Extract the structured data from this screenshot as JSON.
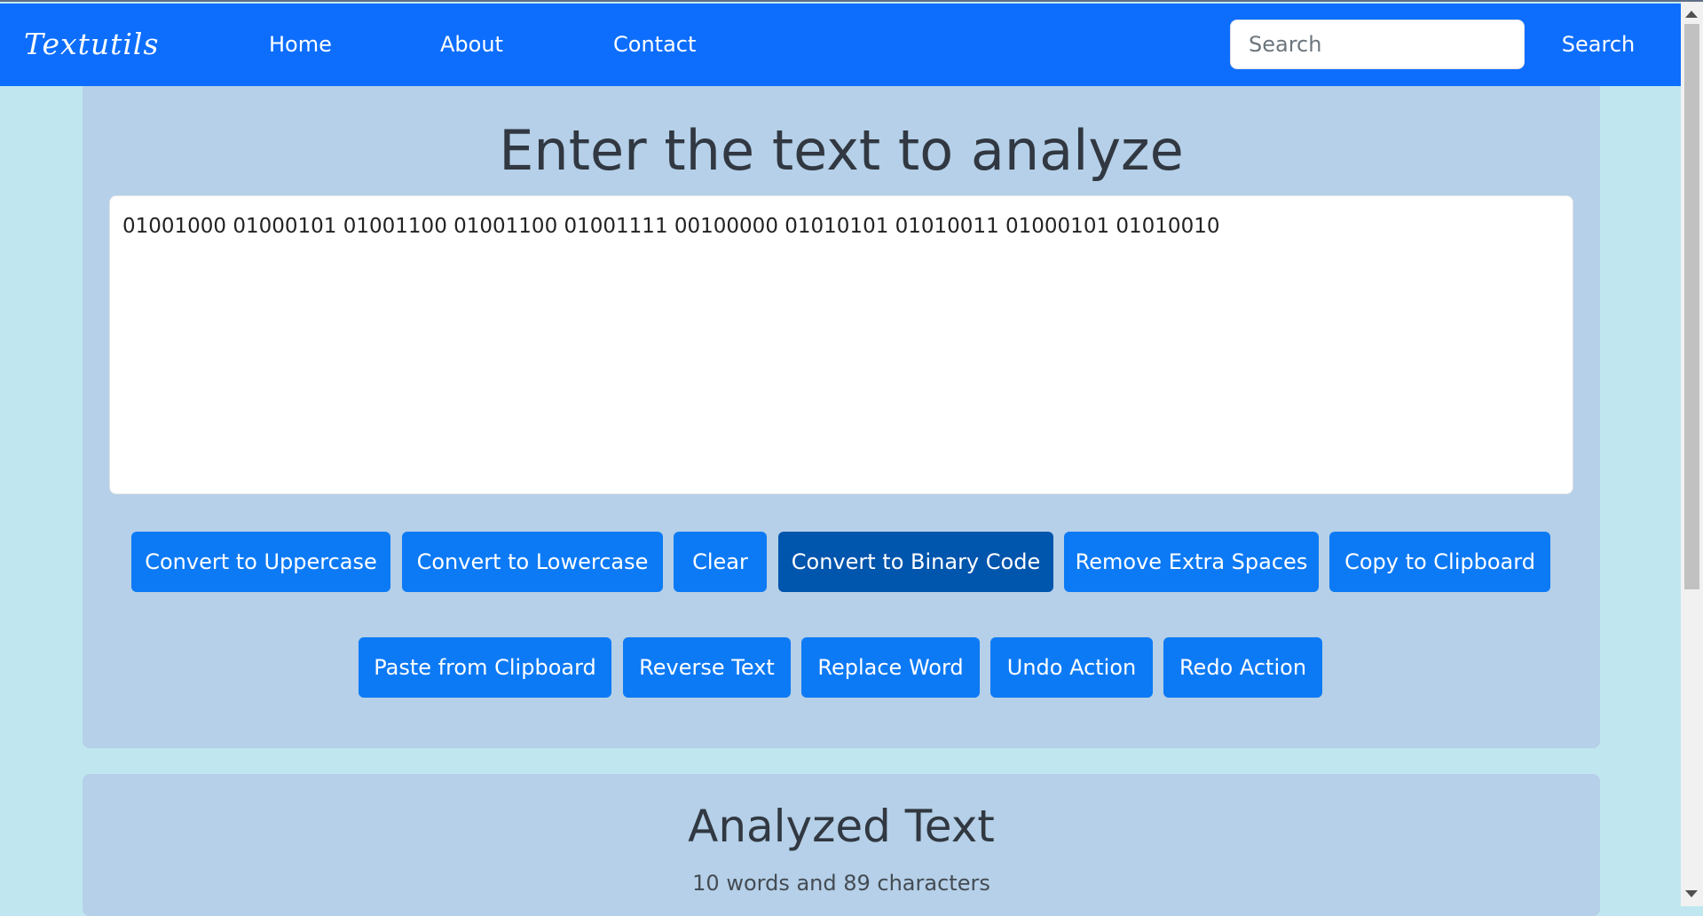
{
  "navbar": {
    "brand": "Textutils",
    "links": [
      "Home",
      "About",
      "Contact"
    ],
    "search_placeholder": "Search",
    "search_button": "Search"
  },
  "main": {
    "heading": "Enter the text to analyze",
    "textarea_value": "01001000 01000101 01001100 01001100 01001111 00100000 01010101 01010011 01000101 01010010",
    "buttons": [
      "Convert to Uppercase",
      "Convert to Lowercase",
      "Clear",
      "Convert to Binary Code",
      "Remove Extra Spaces",
      "Copy to Clipboard",
      "Paste from Clipboard",
      "Reverse Text",
      "Replace Word",
      "Undo Action",
      "Redo Action"
    ]
  },
  "result": {
    "heading": "Analyzed Text",
    "summary": "10 words and 89 characters"
  },
  "colors": {
    "navbar": "#0d6efd",
    "page_background": "#c0e7ef",
    "panel_background": "#b5d0e8",
    "button": "#0d7af5",
    "button_active": "#0055ad"
  }
}
